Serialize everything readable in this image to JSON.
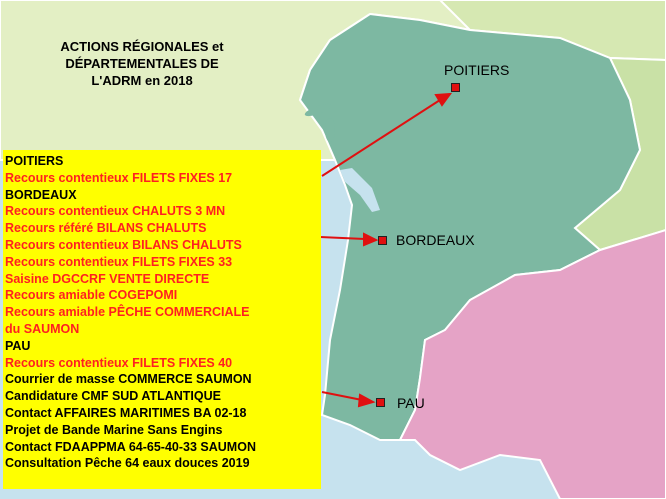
{
  "title": {
    "line1": "ACTIONS RÉGIONALES et",
    "line2": "DÉPARTEMENTALES DE",
    "line3": "L'ADRM en 2018"
  },
  "cities": {
    "poitiers": "POITIERS",
    "bordeaux": "BORDEAUX",
    "pau": "PAU"
  },
  "colors": {
    "sea": "#c6e2ee",
    "region_main": "#7db8a2",
    "region_north": "#e3efc4",
    "region_east": "#c9e1a6",
    "region_south": "#e5a3c6",
    "panel": "#ffff00",
    "arrow": "#e01010"
  },
  "actions": [
    {
      "text": "POITIERS",
      "style": "head"
    },
    {
      "text": "Recours contentieux FILETS FIXES 17",
      "style": "red"
    },
    {
      "text": "BORDEAUX",
      "style": "head"
    },
    {
      "text": "Recours contentieux CHALUTS 3 MN",
      "style": "red"
    },
    {
      "text": "Recours référé BILANS CHALUTS",
      "style": "red"
    },
    {
      "text": "Recours contentieux BILANS CHALUTS",
      "style": "red"
    },
    {
      "text": "Recours contentieux FILETS FIXES 33",
      "style": "red"
    },
    {
      "text": "Saisine DGCCRF VENTE DIRECTE",
      "style": "red"
    },
    {
      "text": "Recours amiable COGEPOMI",
      "style": "red"
    },
    {
      "text": "Recours amiable PÊCHE COMMERCIALE",
      "style": "red"
    },
    {
      "text": "du SAUMON",
      "style": "red"
    },
    {
      "text": "PAU",
      "style": "head"
    },
    {
      "text": "Recours contentieux FILETS FIXES 40",
      "style": "red"
    },
    {
      "text": "Courrier de masse COMMERCE SAUMON",
      "style": "black"
    },
    {
      "text": "Candidature CMF SUD ATLANTIQUE",
      "style": "black"
    },
    {
      "text": "Contact AFFAIRES MARITIMES BA 02-18",
      "style": "black"
    },
    {
      "text": "Projet de Bande Marine Sans Engins",
      "style": "black"
    },
    {
      "text": "Contact FDAAPPMA 64-65-40-33 SAUMON",
      "style": "black"
    },
    {
      "text": "Consultation Pêche 64 eaux douces 2019",
      "style": "black"
    }
  ]
}
